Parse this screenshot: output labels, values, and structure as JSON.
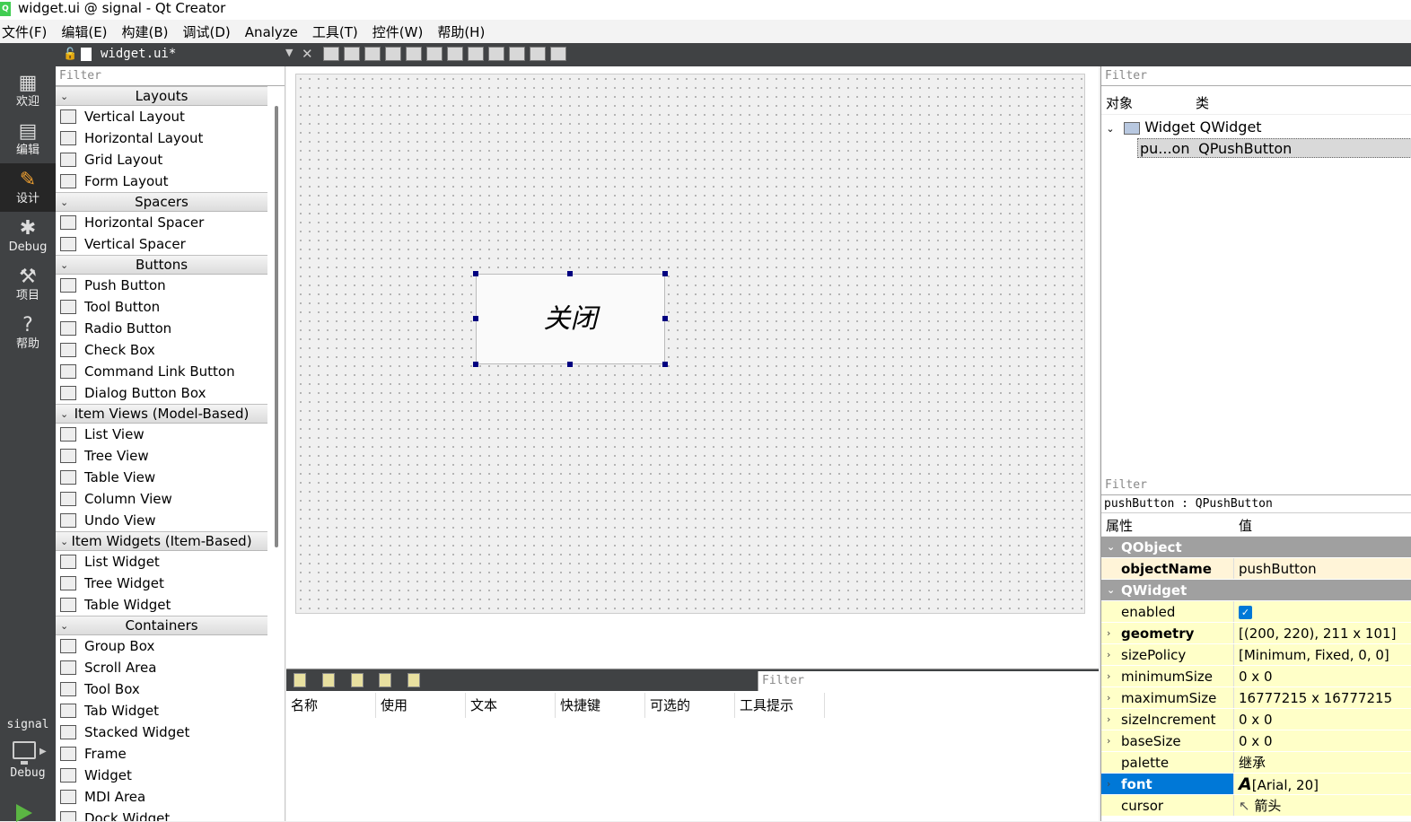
{
  "window": {
    "title": "widget.ui @ signal - Qt Creator"
  },
  "menu": [
    "文件(F)",
    "编辑(E)",
    "构建(B)",
    "调试(D)",
    "Analyze",
    "工具(T)",
    "控件(W)",
    "帮助(H)"
  ],
  "modes": [
    {
      "label": "欢迎",
      "icon": "grid-icon"
    },
    {
      "label": "编辑",
      "icon": "document-icon"
    },
    {
      "label": "设计",
      "icon": "pencil-icon"
    },
    {
      "label": "Debug",
      "icon": "bug-icon"
    },
    {
      "label": "项目",
      "icon": "wrench-icon"
    },
    {
      "label": "帮助",
      "icon": "help-icon"
    }
  ],
  "kit": {
    "project": "signal",
    "config": "Debug"
  },
  "editor": {
    "filename": "widget.ui*"
  },
  "widgetbox": {
    "filter_placeholder": "Filter",
    "categories": [
      {
        "name": "Layouts",
        "items": [
          "Vertical Layout",
          "Horizontal Layout",
          "Grid Layout",
          "Form Layout"
        ]
      },
      {
        "name": "Spacers",
        "items": [
          "Horizontal Spacer",
          "Vertical Spacer"
        ]
      },
      {
        "name": "Buttons",
        "items": [
          "Push Button",
          "Tool Button",
          "Radio Button",
          "Check Box",
          "Command Link Button",
          "Dialog Button Box"
        ]
      },
      {
        "name": "Item Views (Model-Based)",
        "items": [
          "List View",
          "Tree View",
          "Table View",
          "Column View",
          "Undo View"
        ]
      },
      {
        "name": "Item Widgets (Item-Based)",
        "items": [
          "List Widget",
          "Tree Widget",
          "Table Widget"
        ]
      },
      {
        "name": "Containers",
        "items": [
          "Group Box",
          "Scroll Area",
          "Tool Box",
          "Tab Widget",
          "Stacked Widget",
          "Frame",
          "Widget",
          "MDI Area",
          "Dock Widget"
        ]
      }
    ]
  },
  "form": {
    "button_text": "关闭"
  },
  "action_editor": {
    "filter_placeholder": "Filter",
    "columns": [
      "名称",
      "使用",
      "文本",
      "快捷键",
      "可选的",
      "工具提示"
    ]
  },
  "object_inspector": {
    "filter_placeholder": "Filter",
    "columns": [
      "对象",
      "类"
    ],
    "rows": [
      {
        "object": "Widget",
        "class": "QWidget"
      },
      {
        "object": "pu...on",
        "class": "QPushButton"
      }
    ]
  },
  "property_editor": {
    "filter_placeholder": "Filter",
    "object_class": "pushButton : QPushButton",
    "columns": [
      "属性",
      "值"
    ],
    "rows": [
      {
        "type": "section",
        "name": "QObject"
      },
      {
        "name": "objectName",
        "value": "pushButton",
        "bold": true,
        "shade": "y1"
      },
      {
        "type": "section",
        "name": "QWidget"
      },
      {
        "name": "enabled",
        "value": "",
        "check": true,
        "shade": "y2"
      },
      {
        "name": "geometry",
        "value": "[(200, 220), 211 x 101]",
        "bold": true,
        "expand": true,
        "shade": "y2"
      },
      {
        "name": "sizePolicy",
        "value": "[Minimum, Fixed, 0, 0]",
        "expand": true,
        "shade": "y2"
      },
      {
        "name": "minimumSize",
        "value": "0 x 0",
        "expand": true,
        "shade": "y2"
      },
      {
        "name": "maximumSize",
        "value": "16777215 x 16777215",
        "expand": true,
        "shade": "y2"
      },
      {
        "name": "sizeIncrement",
        "value": "0 x 0",
        "expand": true,
        "shade": "y2"
      },
      {
        "name": "baseSize",
        "value": "0 x 0",
        "expand": true,
        "shade": "y2"
      },
      {
        "name": "palette",
        "value": "继承",
        "shade": "y2"
      },
      {
        "name": "font",
        "value": "[Arial, 20]",
        "bold": true,
        "expand": true,
        "selected": true,
        "shade": "y2"
      },
      {
        "name": "cursor",
        "value": "箭头",
        "shade": "y2"
      }
    ]
  }
}
